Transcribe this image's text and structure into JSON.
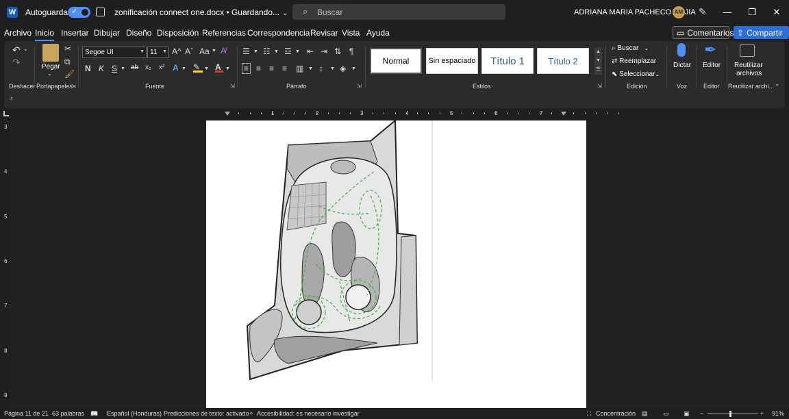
{
  "titlebar": {
    "app_icon": "W",
    "autosave_label": "Autoguardado",
    "document_title": "zonificación connect one.docx • Guardando...",
    "search_placeholder": "Buscar",
    "user_name": "ADRIANA MARIA PACHECO MEJIA",
    "user_initials": "AM"
  },
  "ribbon_tabs": [
    "Archivo",
    "Inicio",
    "Insertar",
    "Dibujar",
    "Diseño",
    "Disposición",
    "Referencias",
    "Correspondencia",
    "Revisar",
    "Vista",
    "Ayuda"
  ],
  "active_tab": "Inicio",
  "actions": {
    "comments": "Comentarios",
    "share": "Compartir"
  },
  "ribbon": {
    "undo_group": "Deshacer",
    "clipboard": {
      "paste": "Pegar",
      "group": "Portapapeles"
    },
    "font": {
      "family": "Segoe UI",
      "size": "11",
      "group": "Fuente",
      "bold": "N",
      "italic": "K",
      "underline": "S",
      "strike": "ab",
      "subscript": "x₂",
      "superscript": "x²",
      "grow": "A^",
      "shrink": "Aˇ",
      "case": "Aa"
    },
    "paragraph": {
      "group": "Párrafo",
      "pilcrow": "¶"
    },
    "styles": {
      "group": "Estilos",
      "items": [
        "Normal",
        "Sin espaciado",
        "Título 1",
        "Título 2"
      ]
    },
    "editing": {
      "group": "Edición",
      "find": "Buscar",
      "replace": "Reemplazar",
      "select": "Seleccionar"
    },
    "voice": {
      "button": "Dictar",
      "group": "Voz"
    },
    "editor": {
      "button": "Editor",
      "group": "Editor"
    },
    "reuse": {
      "button_line1": "Reutilizar",
      "button_line2": "archivos",
      "group": "Reutilizar archi..."
    }
  },
  "rulers": {
    "horizontal": [
      "1",
      "2",
      "3",
      "4",
      "5",
      "6",
      "7"
    ],
    "vertical": [
      "3",
      "4",
      "5",
      "6",
      "7",
      "8",
      "9"
    ]
  },
  "statusbar": {
    "page": "Página 11 de 21",
    "words": "63 palabras",
    "language": "Español (Honduras)",
    "predictions": "Predicciones de texto: activado",
    "accessibility": "Accesibilidad: es necesario investigar",
    "focus": "Concentración",
    "zoom_percent": "91%",
    "zoom_level": 0.91
  },
  "colors": {
    "accent": "#4f8ff7",
    "share_button": "#2b6fd6",
    "avatar": "#c19c4b",
    "background": "#1f1f1f",
    "path_dashes": "#4caf50"
  }
}
